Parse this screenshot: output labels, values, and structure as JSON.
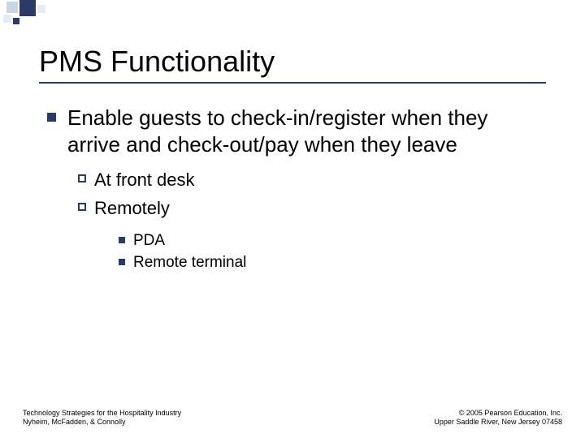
{
  "title": "PMS Functionality",
  "bullets": {
    "main": "Enable guests to check-in/register when they arrive and check-out/pay when they leave",
    "sub1": "At front desk",
    "sub2": "Remotely",
    "sub2a": "PDA",
    "sub2b": "Remote terminal"
  },
  "footer": {
    "left_line1": "Technology Strategies for the Hospitality Industry",
    "left_line2": "Nyheim, McFadden, & Connolly",
    "right_line1": "© 2005 Pearson Education, Inc.",
    "right_line2": "Upper Saddle River, New Jersey 07458"
  }
}
